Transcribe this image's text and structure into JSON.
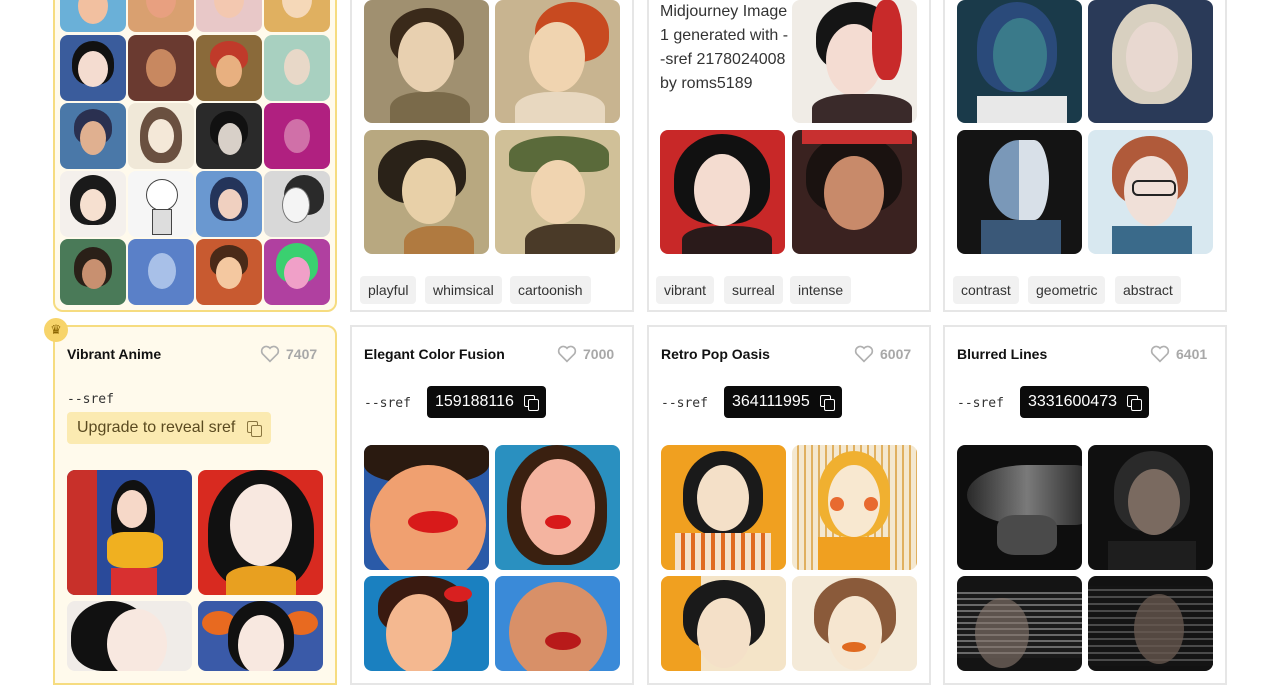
{
  "top_row": [
    {
      "tags": []
    },
    {
      "tags": [
        "playful",
        "whimsical",
        "cartoonish"
      ]
    },
    {
      "broken_image_alt": "Midjourney Image 1 generated with --sref 2178024008 by roms5189",
      "tags": [
        "vibrant",
        "surreal",
        "intense"
      ]
    },
    {
      "tags": [
        "contrast",
        "geometric",
        "abstract"
      ]
    }
  ],
  "cards": [
    {
      "title": "Vibrant Anime",
      "likes": "7407",
      "sref_label": "--sref",
      "upgrade_label": "Upgrade to reveal sref",
      "premium": true
    },
    {
      "title": "Elegant Color Fusion",
      "likes": "7000",
      "sref_label": "--sref",
      "code": "159188116"
    },
    {
      "title": "Retro Pop Oasis",
      "likes": "6007",
      "sref_label": "--sref",
      "code": "364111995"
    },
    {
      "title": "Blurred Lines",
      "likes": "6401",
      "sref_label": "--sref",
      "code": "3331600473"
    }
  ],
  "icons": {
    "heart": "heart-outline-icon",
    "copy": "copy-icon",
    "crown": "crown-icon"
  },
  "colors": {
    "premium_border": "#f6dc80",
    "premium_bg": "#fffaec",
    "code_bg": "#0b0b0b",
    "tag_bg": "#f1f1f1",
    "upgrade_bg": "#fbeab1"
  }
}
